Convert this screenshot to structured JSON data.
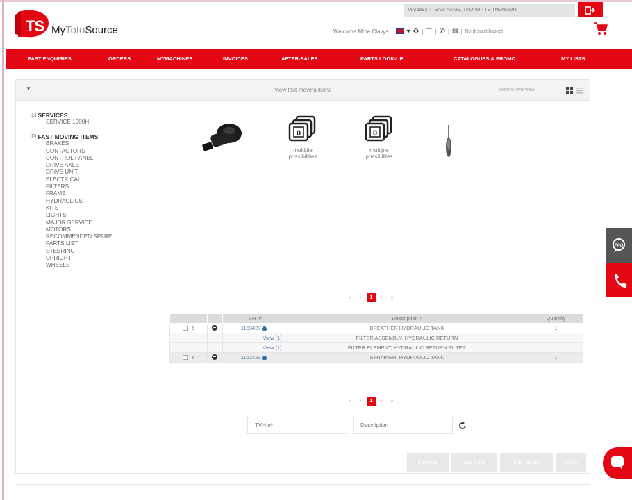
{
  "brand": {
    "logo_short": "TS",
    "name_part1": "My",
    "name_part2": "Toto",
    "name_part3": "Source",
    "accent_color": "#e30613"
  },
  "header": {
    "account_text": "0025993 - TEAM NAME, TNO 00 - TS TM2NMMR",
    "welcome_text": "Welcome Mme Clavys",
    "basket_label": "No default basket"
  },
  "nav": {
    "items": [
      "PAST ENQUIRIES",
      "ORDERS",
      "MYMACHINES",
      "INVOICES",
      "AFTER-SALES",
      "PARTS LOOK-UP",
      "CATALOGUES & PROMO",
      "MY LISTS"
    ]
  },
  "panel": {
    "title": "View fast-moving items",
    "return_label": "Return overview"
  },
  "tree": {
    "groups": [
      {
        "label": "SERVICES",
        "children": [
          "SERVICE 1000H"
        ]
      },
      {
        "label": "FAST MOVING ITEMS",
        "children": [
          "BRAKES",
          "CONTACTORS",
          "CONTROL PANEL",
          "DRIVE AXLE",
          "DRIVE UNIT",
          "ELECTRICAL",
          "FILTERS",
          "FRAME",
          "HYDRAULICS",
          "KITS",
          "LIGHTS",
          "MAJOR SERVICE",
          "MOTORS",
          "RECOMMENDED SPARE",
          "PARTS LIST",
          "STEERING",
          "UPRIGHT",
          "WHEELS"
        ]
      }
    ]
  },
  "thumbnails": [
    {
      "icon": "breather-part-image",
      "caption": ""
    },
    {
      "icon": "multiple-possibilities-icon",
      "caption_line1": "multiple",
      "caption_line2": "possibilities"
    },
    {
      "icon": "multiple-possibilities-icon",
      "caption_line1": "multiple",
      "caption_line2": "possibilites"
    },
    {
      "icon": "strainer-part-image",
      "caption": ""
    }
  ],
  "pager_top": {
    "first": "«",
    "prev": "‹",
    "current": "1",
    "next": "›",
    "last": "»"
  },
  "pager_bottom": {
    "first": "«",
    "prev": "‹",
    "current": "1",
    "next": "›",
    "last": "»"
  },
  "table": {
    "headers": [
      "",
      "",
      "TVH nº",
      "Description ↑",
      "Quantity"
    ],
    "rows": [
      {
        "type": "main",
        "tvh": "1153427",
        "description": "BREATHER HYDRAULIC TANK",
        "quantity": "1"
      },
      {
        "type": "sub",
        "tvh": "View (1)",
        "description": "FILTER ASSEMBLY, HYDRAULIC RETURN",
        "quantity": ""
      },
      {
        "type": "sub",
        "tvh": "View (1)",
        "description": "FILTER ELEMENT, HYDRAULIC RETURN FILTER",
        "quantity": ""
      },
      {
        "type": "main",
        "tvh": "1153423",
        "description": "STRAINER, HYDRAULIC TANK",
        "quantity": "1"
      }
    ]
  },
  "search": {
    "tvh_placeholder": "TVH nº",
    "description_placeholder": "Description"
  },
  "actions": [
    "Compare",
    "Add to list",
    "Order basket",
    "Delete"
  ]
}
